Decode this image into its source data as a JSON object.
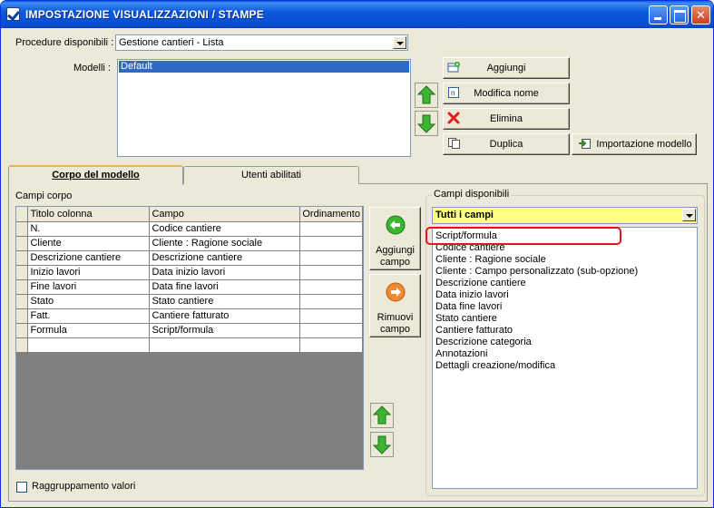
{
  "window": {
    "title": "IMPOSTAZIONE VISUALIZZAZIONI / STAMPE",
    "minimize": "",
    "maximize": "",
    "close": "✕"
  },
  "procedure": {
    "label": "Procedure disponibili :",
    "selected": "Gestione cantieri - Lista"
  },
  "modelli": {
    "label": "Modelli :",
    "items": [
      "Default"
    ],
    "buttons": {
      "aggiungi": "Aggiungi",
      "modifica_nome": "Modifica nome",
      "elimina": "Elimina",
      "duplica": "Duplica",
      "importazione": "Importazione modello"
    }
  },
  "tabs": [
    "Corpo del modello",
    "Utenti abilitati"
  ],
  "campi_corpo": {
    "title": "Campi corpo",
    "columns": [
      "Titolo colonna",
      "Campo",
      "Ordinamento"
    ],
    "rows": [
      [
        "N.",
        "Codice cantiere",
        ""
      ],
      [
        "Cliente",
        "Cliente : Ragione sociale",
        ""
      ],
      [
        "Descrizione cantiere",
        "Descrizione cantiere",
        ""
      ],
      [
        "Inizio lavori",
        "Data inizio lavori",
        ""
      ],
      [
        "Fine lavori",
        "Data fine lavori",
        ""
      ],
      [
        "Stato",
        "Stato cantiere",
        ""
      ],
      [
        "Fatt.",
        "Cantiere fatturato",
        ""
      ],
      [
        "Formula",
        "Script/formula",
        ""
      ],
      [
        "",
        "",
        ""
      ]
    ]
  },
  "actions": {
    "aggiungi_campo": [
      "Aggiungi",
      "campo"
    ],
    "rimuovi_campo": [
      "Rimuovi",
      "campo"
    ]
  },
  "campi_disponibili": {
    "title": "Campi disponibili",
    "filter": "Tutti i campi",
    "items": [
      "Script/formula",
      "Codice cantiere",
      "Cliente : Ragione sociale",
      "Cliente : Campo personalizzato (sub-opzione)",
      "Descrizione cantiere",
      "Data inizio lavori",
      "Data fine lavori",
      "Stato cantiere",
      "Cantiere fatturato",
      "Descrizione categoria",
      "Annotazioni",
      "Dettagli creazione/modifica"
    ],
    "filter_color": "#ffff80",
    "highlight_color": "#e8121c"
  },
  "raggruppamento": {
    "label": "Raggruppamento valori",
    "checked": false
  }
}
